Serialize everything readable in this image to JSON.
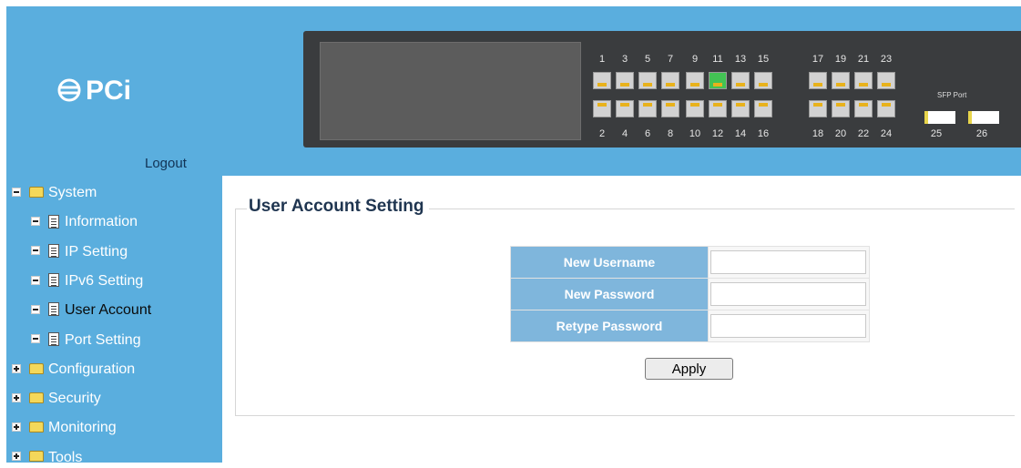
{
  "header": {
    "logo_text": "PCi",
    "logout_label": "Logout"
  },
  "switch_panel": {
    "top_port_numbers": [
      "1",
      "3",
      "5",
      "7",
      "9",
      "11",
      "13",
      "15",
      "17",
      "19",
      "21",
      "23"
    ],
    "bottom_port_numbers": [
      "2",
      "4",
      "6",
      "8",
      "10",
      "12",
      "14",
      "16",
      "18",
      "20",
      "22",
      "24"
    ],
    "active_port": "11",
    "sfp_label": "SFP Port",
    "sfp_ports": [
      "25",
      "26"
    ]
  },
  "sidebar": {
    "items": [
      {
        "label": "System",
        "type": "folder-open",
        "toggle": "minus",
        "level": 0
      },
      {
        "label": "Information",
        "type": "page",
        "toggle": "minus",
        "level": 1
      },
      {
        "label": "IP Setting",
        "type": "page",
        "toggle": "minus",
        "level": 1
      },
      {
        "label": "IPv6 Setting",
        "type": "page",
        "toggle": "minus",
        "level": 1
      },
      {
        "label": "User Account",
        "type": "page",
        "toggle": "minus",
        "level": 1,
        "selected": true
      },
      {
        "label": "Port Setting",
        "type": "page",
        "toggle": "minus",
        "level": 1
      },
      {
        "label": "Configuration",
        "type": "folder",
        "toggle": "plus",
        "level": 0
      },
      {
        "label": "Security",
        "type": "folder",
        "toggle": "plus",
        "level": 0
      },
      {
        "label": "Monitoring",
        "type": "folder",
        "toggle": "plus",
        "level": 0
      },
      {
        "label": "Tools",
        "type": "folder",
        "toggle": "plus",
        "level": 0
      }
    ]
  },
  "main": {
    "title": "User Account Setting",
    "form": {
      "new_username_label": "New Username",
      "new_username_value": "",
      "new_password_label": "New Password",
      "new_password_value": "",
      "retype_password_label": "Retype Password",
      "retype_password_value": ""
    },
    "apply_label": "Apply"
  },
  "colors": {
    "header_bg": "#5aaede",
    "sidebar_bg": "#5aaede",
    "form_label_bg": "#7fb6dc",
    "switch_body": "#3a3c3e",
    "port_led": "#e8b21c",
    "active_port": "#43c254"
  }
}
